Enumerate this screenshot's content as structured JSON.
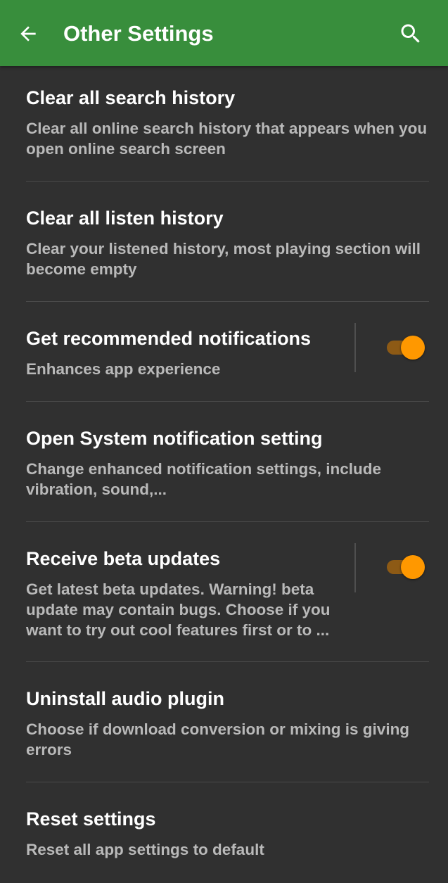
{
  "appbar": {
    "title": "Other Settings",
    "back_icon": "arrow-left-icon",
    "search_icon": "search-icon",
    "color": "#388e3c"
  },
  "settings": [
    {
      "title": "Clear all search history",
      "subtitle": "Clear all online search history that appears when you open online search screen"
    },
    {
      "title": "Clear all listen history",
      "subtitle": "Clear your listened history, most playing section will become empty"
    },
    {
      "title": "Get recommended notifications",
      "subtitle": "Enhances app experience",
      "toggle": true
    },
    {
      "title": "Open System notification setting",
      "subtitle": "Change enhanced notification settings, include vibration, sound,..."
    },
    {
      "title": "Receive beta updates",
      "subtitle": "Get latest beta updates. Warning! beta update may contain bugs. Choose if you want to try out cool features first or to ...",
      "toggle": true
    },
    {
      "title": "Uninstall audio plugin",
      "subtitle": "Choose if download conversion or mixing is giving errors"
    },
    {
      "title": "Reset settings",
      "subtitle": "Reset all app settings to default"
    }
  ],
  "colors": {
    "background": "#303030",
    "accent": "#ff9800",
    "subtitle": "#b9b9b9"
  }
}
